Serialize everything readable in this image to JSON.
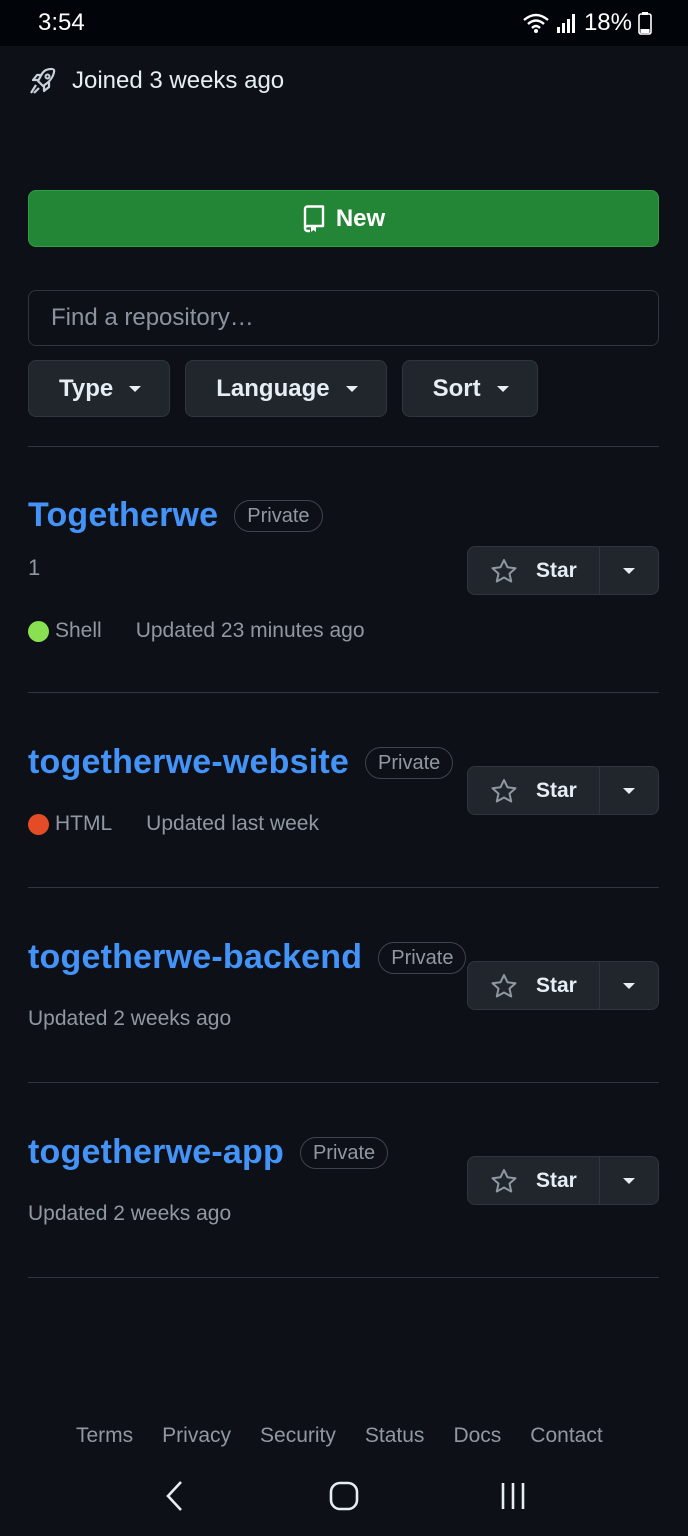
{
  "status_bar": {
    "time": "3:54",
    "battery": "18%"
  },
  "profile": {
    "joined": "Joined 3 weeks ago"
  },
  "new_button": {
    "label": "New"
  },
  "search": {
    "placeholder": "Find a repository…",
    "value": ""
  },
  "filters": [
    {
      "label": "Type"
    },
    {
      "label": "Language"
    },
    {
      "label": "Sort"
    }
  ],
  "repos": [
    {
      "name": "Togetherwe",
      "visibility": "Private",
      "description": "1",
      "language": "Shell",
      "language_color": "#89e051",
      "updated": "Updated 23 minutes ago",
      "star_label": "Star"
    },
    {
      "name": "togetherwe-website",
      "visibility": "Private",
      "language": "HTML",
      "language_color": "#e34c26",
      "updated": "Updated last week",
      "star_label": "Star"
    },
    {
      "name": "togetherwe-backend",
      "visibility": "Private",
      "updated": "Updated 2 weeks ago",
      "star_label": "Star"
    },
    {
      "name": "togetherwe-app",
      "visibility": "Private",
      "updated": "Updated 2 weeks ago",
      "star_label": "Star"
    }
  ],
  "footer": {
    "links": [
      "Terms",
      "Privacy",
      "Security",
      "Status",
      "Docs",
      "Contact"
    ]
  },
  "colors": {
    "background": "#0d1117",
    "accent_link": "#4493f8",
    "new_button": "#238636"
  }
}
